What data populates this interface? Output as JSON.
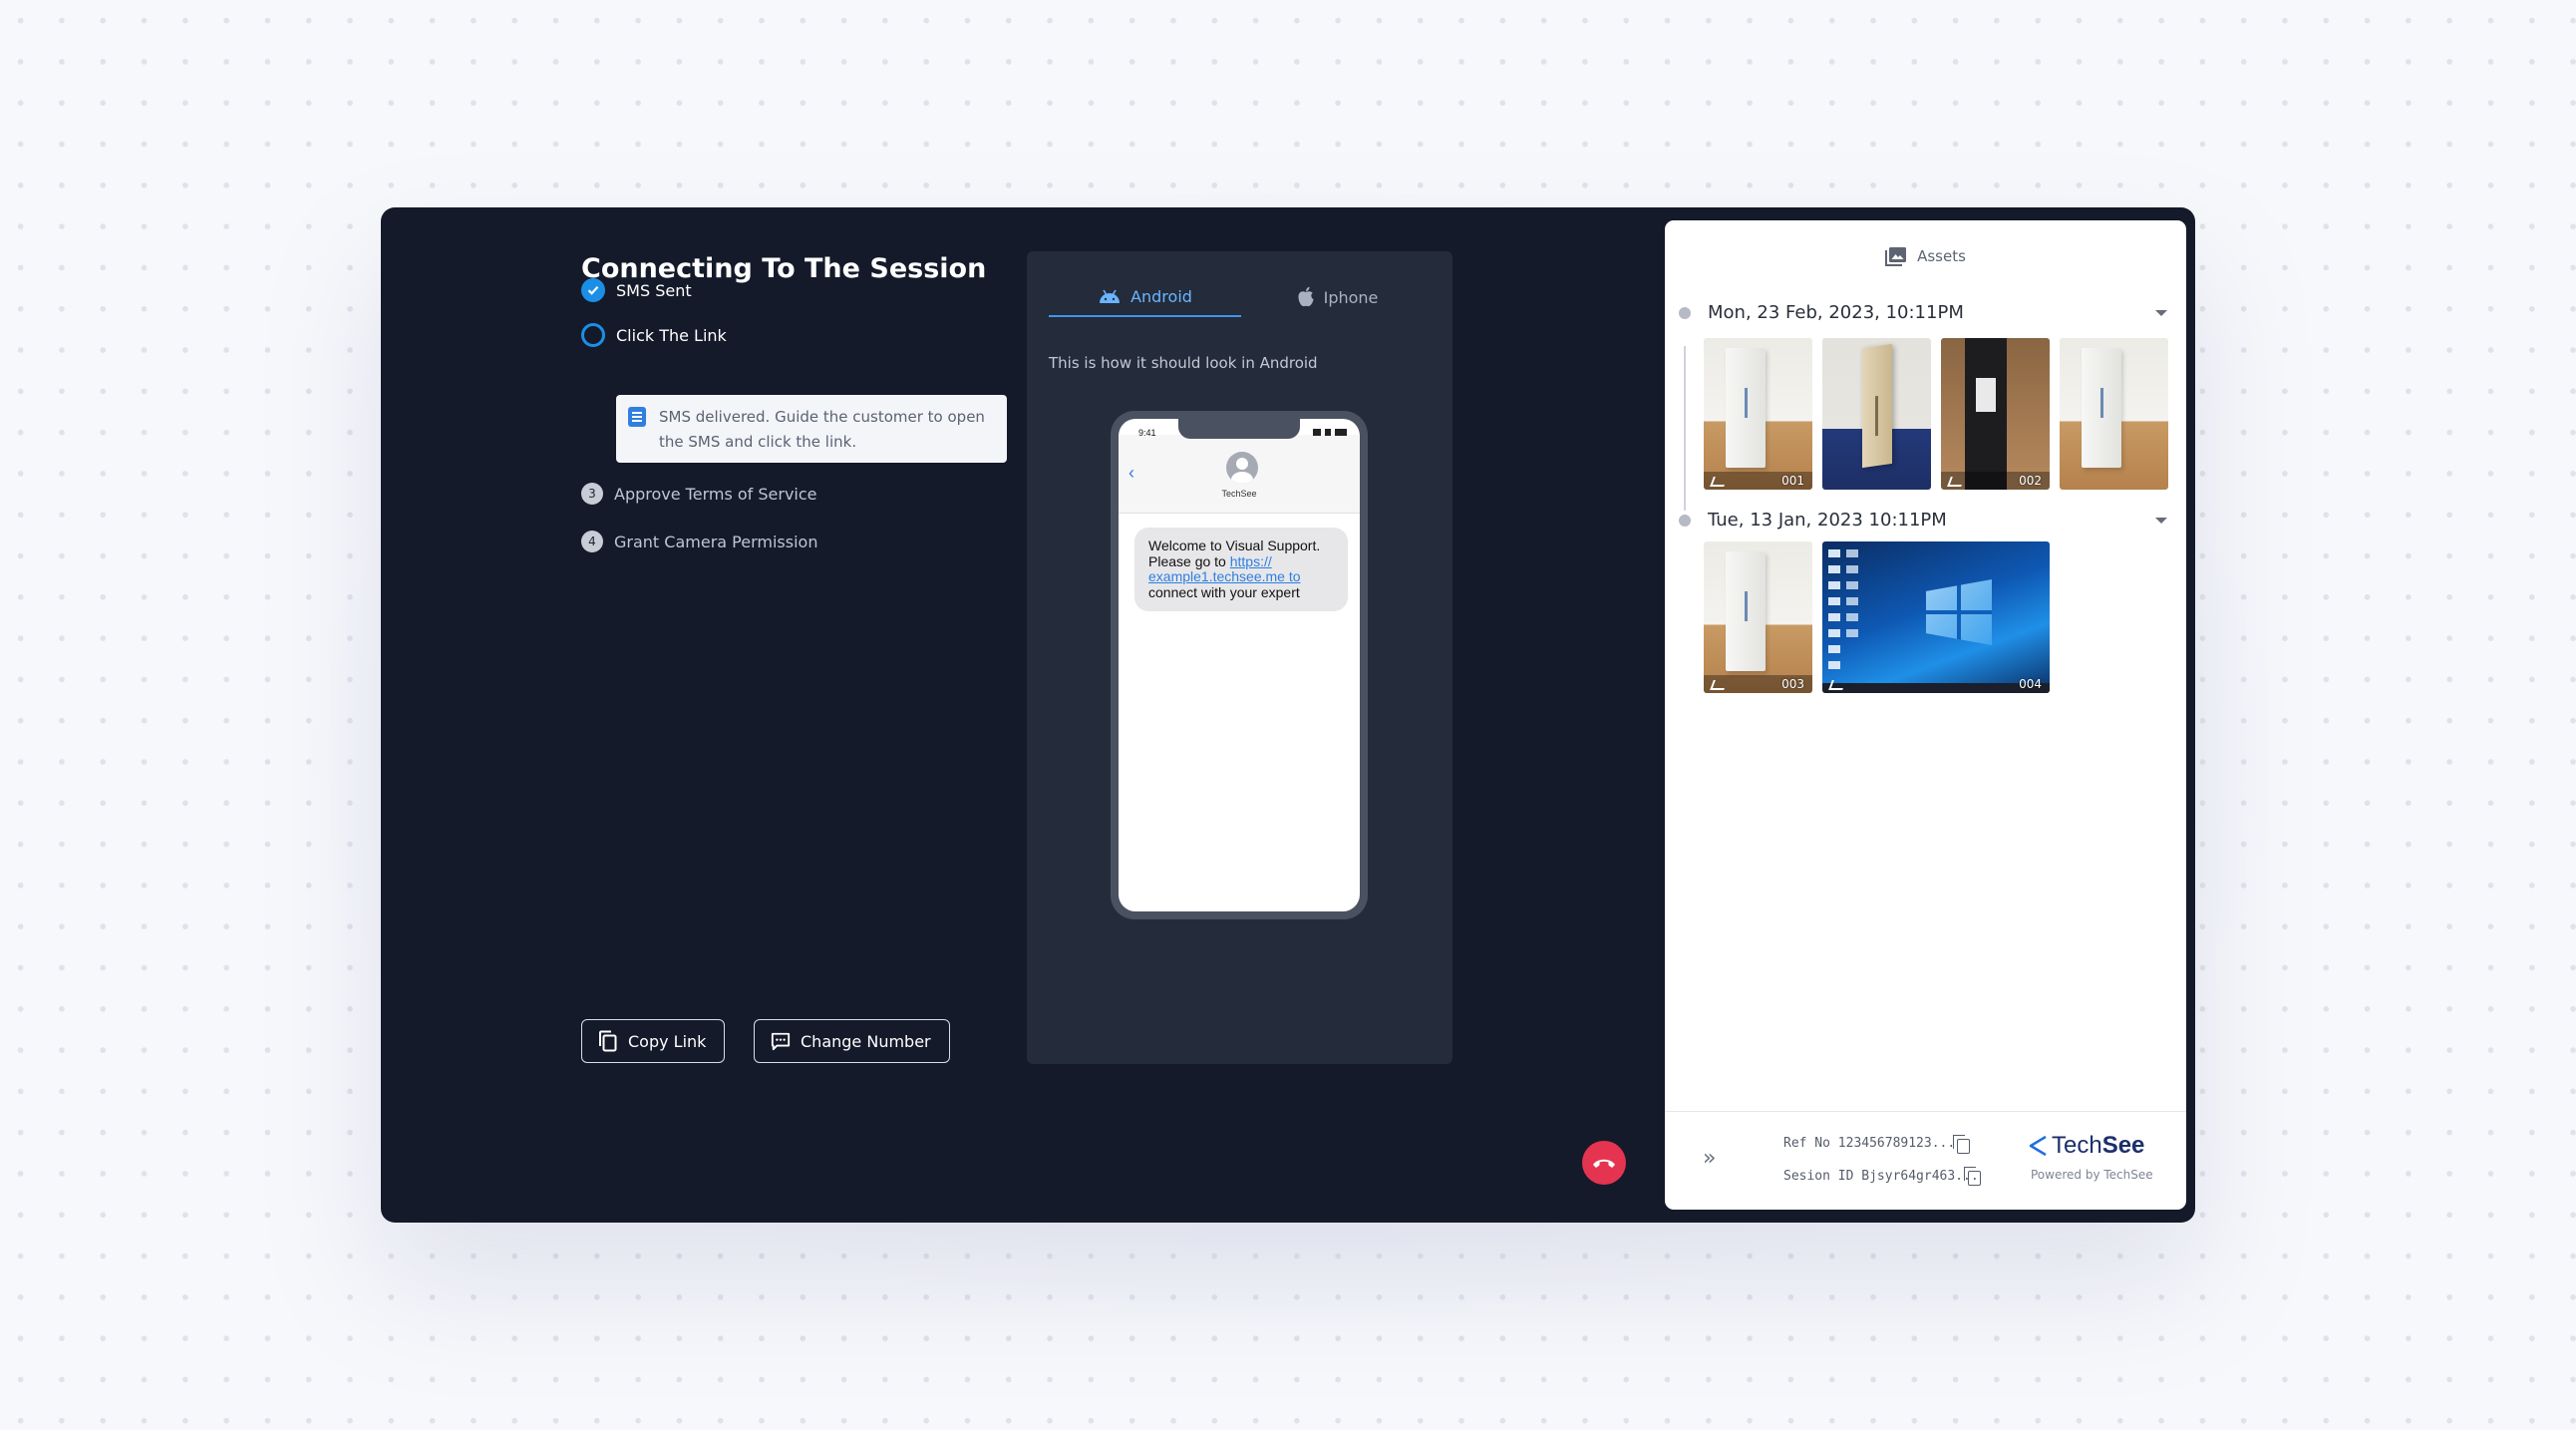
{
  "session": {
    "title": "Connecting To The Session",
    "steps": [
      {
        "label": "SMS Sent",
        "state": "done"
      },
      {
        "label": "Click The Link",
        "state": "active"
      },
      {
        "num": "3",
        "label": "Approve Terms of Service",
        "state": "pending"
      },
      {
        "num": "4",
        "label": "Grant Camera Permission",
        "state": "pending"
      }
    ],
    "note": "SMS delivered. Guide the customer to open the SMS and click the link.",
    "buttons": {
      "copy_link": "Copy Link",
      "change_number": "Change Number"
    }
  },
  "preview": {
    "tabs": [
      {
        "label": "Android",
        "active": true,
        "icon": "android-icon"
      },
      {
        "label": "Iphone",
        "active": false,
        "icon": "apple-icon"
      }
    ],
    "caption": "This is how it should look in Android",
    "phone": {
      "time": "9:41",
      "contact": "TechSee",
      "message_intro": "Welcome to Visual Support. Please go to ",
      "message_link": "https:// example1.techsee.me to",
      "message_outro": " connect with your expert"
    }
  },
  "assets": {
    "header": "Assets",
    "groups": [
      {
        "date": "Mon, 23 Feb, 2023, 10:11PM",
        "items": [
          "001",
          "",
          "002",
          ""
        ]
      },
      {
        "date": "Tue, 13 Jan, 2023 10:11PM",
        "items": [
          "003",
          "004"
        ]
      }
    ],
    "footer": {
      "ref_no": "Ref No 123456789123...",
      "session_id": "Sesion ID Bjsyr64gr463...",
      "brand_tech": "Tech",
      "brand_see": "See",
      "powered_by": "Powered by TechSee"
    }
  },
  "colors": {
    "app_bg": "#141a2a",
    "accent": "#1b8fe6",
    "hangup": "#e5344f",
    "brand": "#1c2f6b"
  }
}
